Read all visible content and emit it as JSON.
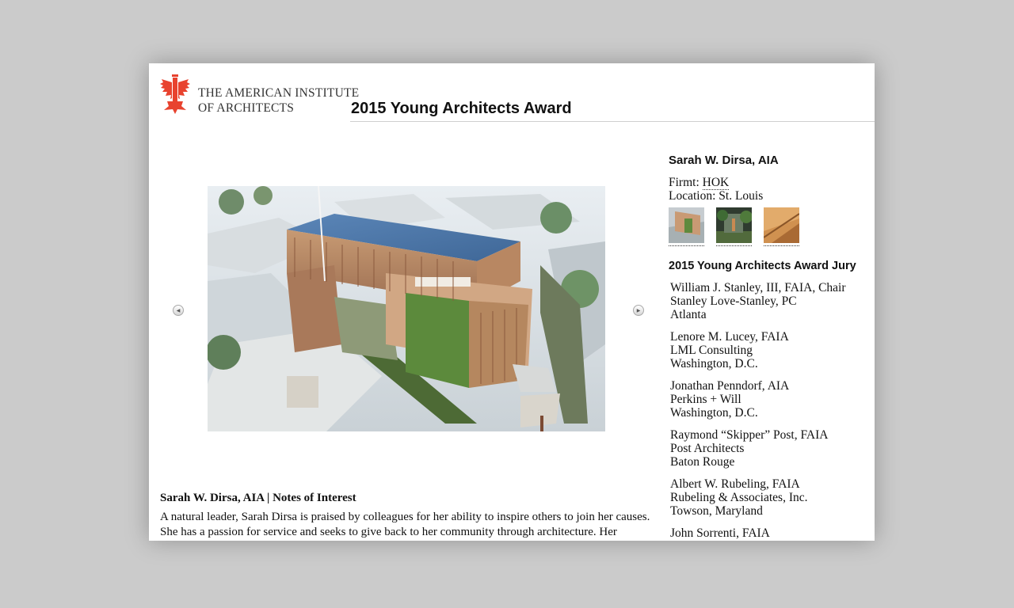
{
  "header": {
    "logo_line1": "THE AMERICAN INSTITUTE",
    "logo_line2": "OF ARCHITECTS",
    "page_title": "2015 Young Architects Award"
  },
  "carousel": {
    "prev_icon": "chevron-left-icon",
    "next_icon": "chevron-right-icon",
    "image": "architectural rendering of building with green wall"
  },
  "notes": {
    "heading": "Sarah W. Dirsa, AIA | Notes of Interest",
    "line1": "A natural leader, Sarah Dirsa is praised by colleagues for her ability to inspire others to join her causes.",
    "line2": "She has a passion for service and seeks to give back to her community through architecture. Her personal"
  },
  "winner": {
    "name": "Sarah W. Dirsa, AIA",
    "firm_label": "Firmt:",
    "firm": "HOK",
    "location_label": "Location:",
    "location": "St. Louis"
  },
  "jury": {
    "heading": "2015 Young Architects Award Jury",
    "members": [
      {
        "name": "William J. Stanley, III, FAIA, Chair",
        "firm": "Stanley Love-Stanley, PC",
        "city": "Atlanta"
      },
      {
        "name": "Lenore M. Lucey, FAIA",
        "firm": "LML Consulting",
        "city": "Washington, D.C."
      },
      {
        "name": "Jonathan Penndorf, AIA",
        "firm": "Perkins + Will",
        "city": "Washington, D.C."
      },
      {
        "name": "Raymond “Skipper” Post, FAIA",
        "firm": "Post Architects",
        "city": "Baton Rouge"
      },
      {
        "name": "Albert W. Rubeling, FAIA",
        "firm": "Rubeling & Associates, Inc.",
        "city": "Towson, Maryland"
      },
      {
        "name": "John Sorrenti, FAIA",
        "firm": "",
        "city": ""
      }
    ]
  },
  "colors": {
    "brand_red": "#e8432f",
    "background": "#cbcbcb"
  }
}
